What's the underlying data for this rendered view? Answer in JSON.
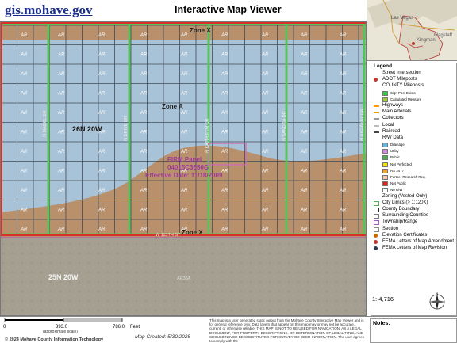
{
  "header": {
    "site_link": "gis.mohave.gov",
    "title": "Interactive Map Viewer"
  },
  "overview": {
    "labels": [
      "Las Vegas",
      "Kingman",
      "Flagstaff"
    ]
  },
  "map": {
    "parcel_label": "AR",
    "zone_labels": {
      "zone_x_top": "Zone X",
      "zone_a": "Zone A",
      "zone_x_bottom": "Zone X"
    },
    "township": "26N 20W",
    "township_lower": "25N 20W",
    "streets": {
      "s1": "N MABEL DR",
      "s2": "N DRIVE DR",
      "s3": "N KATHLEEN DR",
      "s4": "N SANDRA DR",
      "s5": "N HIGHWAY DR",
      "s6": "W 115TH ST"
    },
    "firm_panel": {
      "line1": "FIRM Panel",
      "line2": "04015C3650G",
      "line3": "Effective Date: 11/18/2009"
    },
    "lower_zone_label": "AR36A"
  },
  "legend": {
    "title": "Legend",
    "items": [
      {
        "label": "Street Intersection",
        "type": "plain"
      },
      {
        "label": "ADOT Mileposts",
        "type": "icon",
        "color": "#c0392b"
      },
      {
        "label": "COUNTY Mileposts",
        "type": "plain"
      },
      {
        "label": "Sign Post Exists",
        "type": "sub",
        "color": "#2ecc40"
      },
      {
        "label": "Calculated Measure",
        "type": "sub",
        "color": "#9acd32"
      },
      {
        "label": "Highways",
        "type": "line",
        "color": "#ff9900"
      },
      {
        "label": "Main Arterials",
        "type": "line",
        "color": "#e0a000"
      },
      {
        "label": "Collectors",
        "type": "line",
        "color": "#999999"
      },
      {
        "label": "Local",
        "type": "line",
        "color": "#bbbbbb"
      },
      {
        "label": "Railroad",
        "type": "line",
        "color": "#444444"
      },
      {
        "label": "R/W Data",
        "type": "plain"
      },
      {
        "label": "Drainage",
        "type": "sub",
        "color": "#5fb4e8"
      },
      {
        "label": "Utility",
        "type": "sub",
        "color": "#d58ae6"
      },
      {
        "label": "Public",
        "type": "sub",
        "color": "#4caf50"
      },
      {
        "label": "Not Perfected",
        "type": "sub",
        "color": "#f2e600"
      },
      {
        "label": "RS 2477",
        "type": "sub",
        "color": "#f5a623"
      },
      {
        "label": "Further Research Req.",
        "type": "sub",
        "color": "#f6c6b6"
      },
      {
        "label": "Not Public",
        "type": "sub",
        "color": "#e0201f"
      },
      {
        "label": "No R/W",
        "type": "sub",
        "color": "#ffffff"
      },
      {
        "label": "Zoning (Vested Only)",
        "type": "plain"
      },
      {
        "label": "City Limits (> 1:120K)",
        "type": "box",
        "color": "#4caf50"
      },
      {
        "label": "County Boundary",
        "type": "box",
        "color": "#222222"
      },
      {
        "label": "Surrounding Counties",
        "type": "box",
        "color": "#777777"
      },
      {
        "label": "Township/Range",
        "type": "box",
        "color": "#aa55cc"
      },
      {
        "label": "Section",
        "type": "box",
        "color": "#888888"
      },
      {
        "label": "Elevation Certificates",
        "type": "dot",
        "color": "#cc6600"
      },
      {
        "label": "FEMA Letters of Map Amendment",
        "type": "dot",
        "color": "#c0392b"
      },
      {
        "label": "FEMA Letters of Map Revision",
        "type": "dot",
        "color": "#2c3e50"
      }
    ]
  },
  "scale": {
    "ratio": "1: 4,716",
    "ticks": [
      "0",
      "393.0",
      "786.0"
    ],
    "unit": "Feet",
    "caption": "(approximate scale)"
  },
  "footer": {
    "created": "Map Created: 5/30/2025",
    "copyright": "© 2024 Mohave County Information Technology",
    "disclaimer": "This map is a user generated static output from the Mohave County Interactive Map Viewer and is for general reference only. Data layers that appear on this map may or may not be accurate, current, or otherwise reliable. THIS MAP IS NOT TO BE USED FOR NAVIGATION, AS A LEGAL DOCUMENT, FOR PROPERTY DESCRIPTIONS, OR DETERMINATION OF LEGAL TITLE, AND SHOULD NEVER BE SUBSTITUTED FOR SURVEY OR DEED INFORMATION. The user agrees to comply with the",
    "notes_label": "Notes:"
  },
  "colors": {
    "flood_blue": "#a7c6dd",
    "dirt_brown": "#b9906c",
    "green_line": "#57c457",
    "red_border": "#d9302a",
    "parcel_line": "#404a55"
  }
}
